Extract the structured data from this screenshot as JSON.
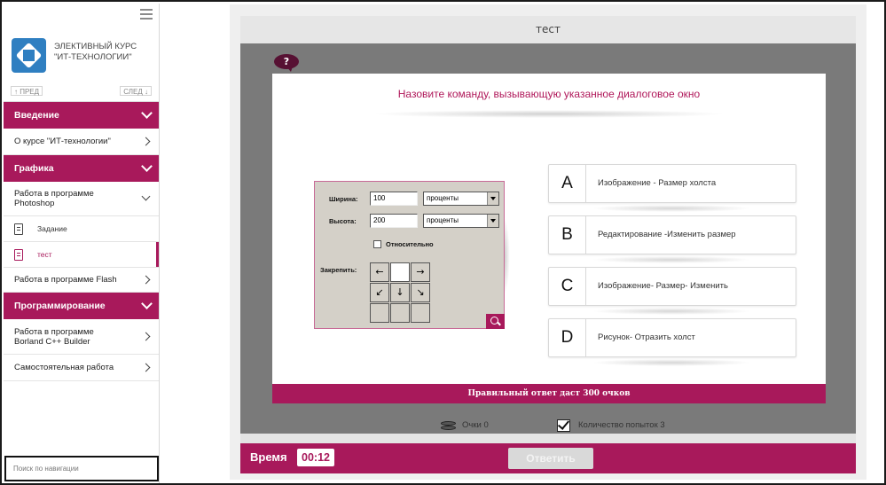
{
  "sidebar": {
    "course_title_line1": "ЭЛЕКТИВНЫЙ КУРС",
    "course_title_line2": "\"ИТ-ТЕХНОЛОГИИ\"",
    "prev_label": "↑ ПРЕД",
    "next_label": "СЛЕД ↓",
    "sections": [
      {
        "title": "Введение",
        "items": [
          {
            "label": "О курсе \"ИТ-технологии\""
          }
        ]
      },
      {
        "title": "Графика",
        "items": [
          {
            "label_line1": "Работа в программе",
            "label_line2": "Photoshop",
            "children": [
              {
                "label": "Задание"
              },
              {
                "label": "тест",
                "active": true
              }
            ]
          },
          {
            "label": "Работа в программе Flash"
          }
        ]
      },
      {
        "title": "Программирование",
        "items": [
          {
            "label_line1": "Работа в программе",
            "label_line2": "Borland C++ Builder"
          },
          {
            "label": "Самостоятельная работа"
          }
        ]
      }
    ],
    "search_placeholder": "Поиск по навигации"
  },
  "slide": {
    "title": "тест",
    "help_icon": "question-bubble-icon",
    "question": "Назовите команду, вызывающую указанное диалоговое окно",
    "dialog": {
      "width_label": "Ширина:",
      "width_value": "100",
      "width_unit": "проценты",
      "height_label": "Высота:",
      "height_value": "200",
      "height_unit": "проценты",
      "relative_label": "Относительно",
      "anchor_label": "Закрепить:",
      "anchor_arrows": [
        "←",
        "",
        "→",
        "↙",
        "↓",
        "↘",
        "",
        "",
        ""
      ]
    },
    "options": [
      {
        "letter": "A",
        "text": "Изображение - Размер холста"
      },
      {
        "letter": "B",
        "text": "Редактирование -Изменить размер"
      },
      {
        "letter": "C",
        "text": "Изображение- Размер- Изменить"
      },
      {
        "letter": "D",
        "text": "Рисунок- Отразить холст"
      }
    ],
    "answer_banner": "Правильный ответ даст 300 очков"
  },
  "stats": {
    "score_label": "Очки 0",
    "attempts_label": "Количество попыток 3"
  },
  "footer": {
    "time_label": "Время",
    "time_value": "00:12",
    "submit_label": "Ответить"
  },
  "colors": {
    "accent": "#a8195b",
    "slide_frame": "#7a7a7a",
    "logo_blue": "#2f7fc1"
  }
}
